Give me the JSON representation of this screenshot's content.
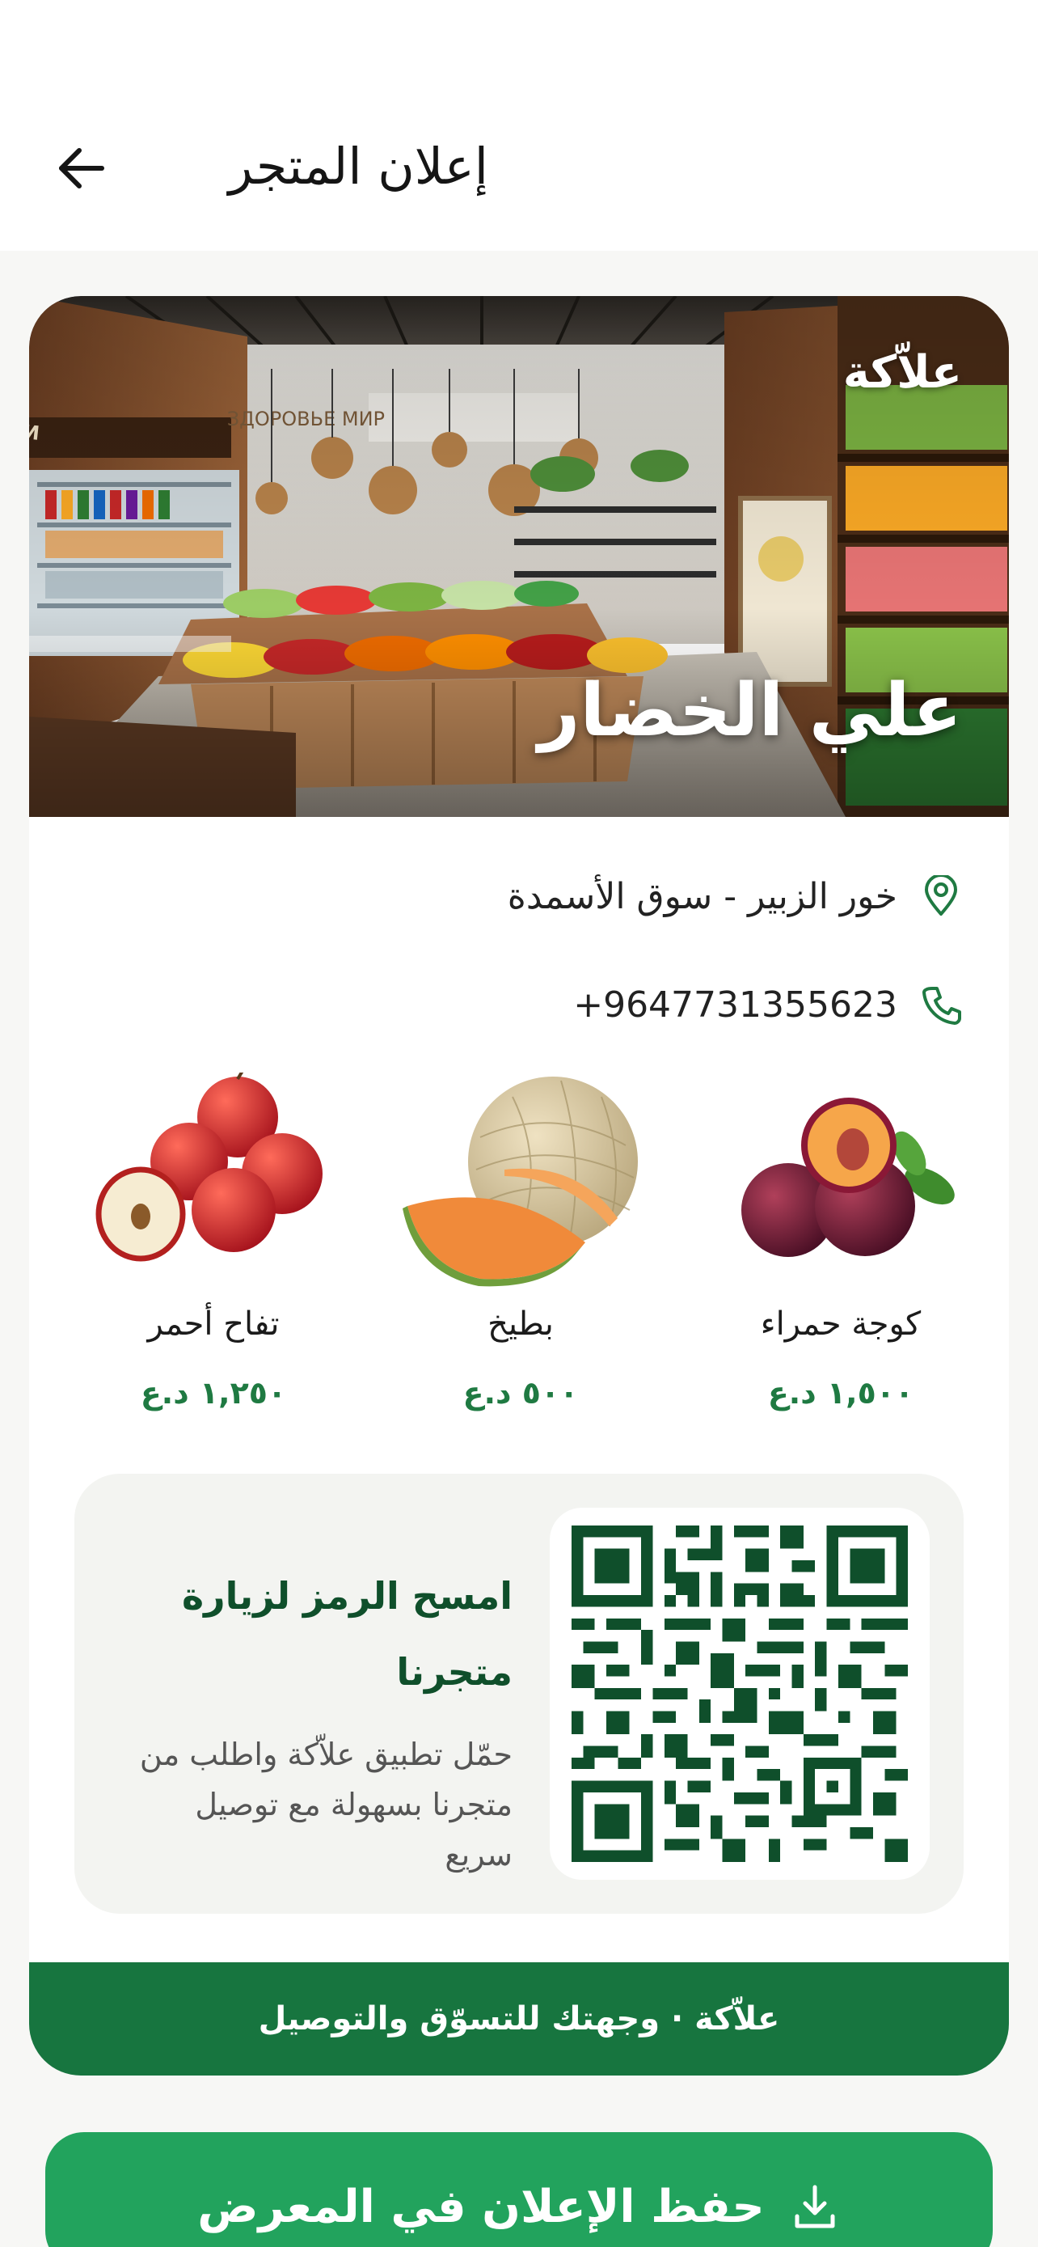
{
  "header": {
    "title": "إعلان المتجر",
    "back_icon": "arrow-left-icon"
  },
  "store": {
    "brand": "علاّكة",
    "name": "علي الخضار",
    "location": "خور الزبير - سوق الأسمدة",
    "phone": "+9647731355623",
    "location_icon": "map-pin-icon",
    "phone_icon": "phone-icon"
  },
  "products": [
    {
      "name": "كوجة حمراء",
      "price": "١,٥٠٠ د.ع"
    },
    {
      "name": "بطيخ",
      "price": "٥٠٠ د.ع"
    },
    {
      "name": "تفاح أحمر",
      "price": "١,٢٥٠ د.ع"
    }
  ],
  "qr": {
    "title": "امسح الرمز لزيارة متجرنا",
    "description": "حمّل تطبيق علاّكة واطلب من متجرنا بسهولة مع توصيل سريع"
  },
  "banner": {
    "text": "علاّكة · وجهتك للتسوّق والتوصيل"
  },
  "save_button": {
    "label": "حفظ الإعلان في المعرض",
    "icon": "download-icon"
  },
  "colors": {
    "primary_green": "#17753f",
    "button_green": "#22a35d",
    "price_green": "#1f7a42",
    "qr_dark": "#0f4f2b"
  }
}
